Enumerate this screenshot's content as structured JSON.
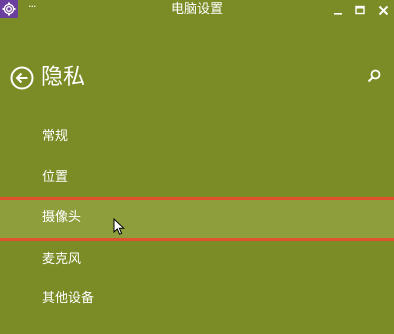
{
  "window": {
    "title": "电脑设置",
    "menu_glyph": "···",
    "app_icon": "gear-icon",
    "controls": [
      "minimize-icon",
      "maximize-icon",
      "close-icon"
    ]
  },
  "page": {
    "title": "隐私",
    "back_icon": "back-arrow-icon",
    "search_icon": "search-icon"
  },
  "nav": {
    "items": [
      {
        "label": "常规",
        "selected": false
      },
      {
        "label": "位置",
        "selected": false
      },
      {
        "label": "摄像头",
        "selected": true
      },
      {
        "label": "麦克风",
        "selected": false
      },
      {
        "label": "其他设备",
        "selected": false
      }
    ]
  },
  "colors": {
    "background": "#7b8b25",
    "selected_background": "#8e9e3c",
    "selection_border": "#e0522e",
    "app_icon_background": "#6b3fa0",
    "text": "#ffffff"
  }
}
